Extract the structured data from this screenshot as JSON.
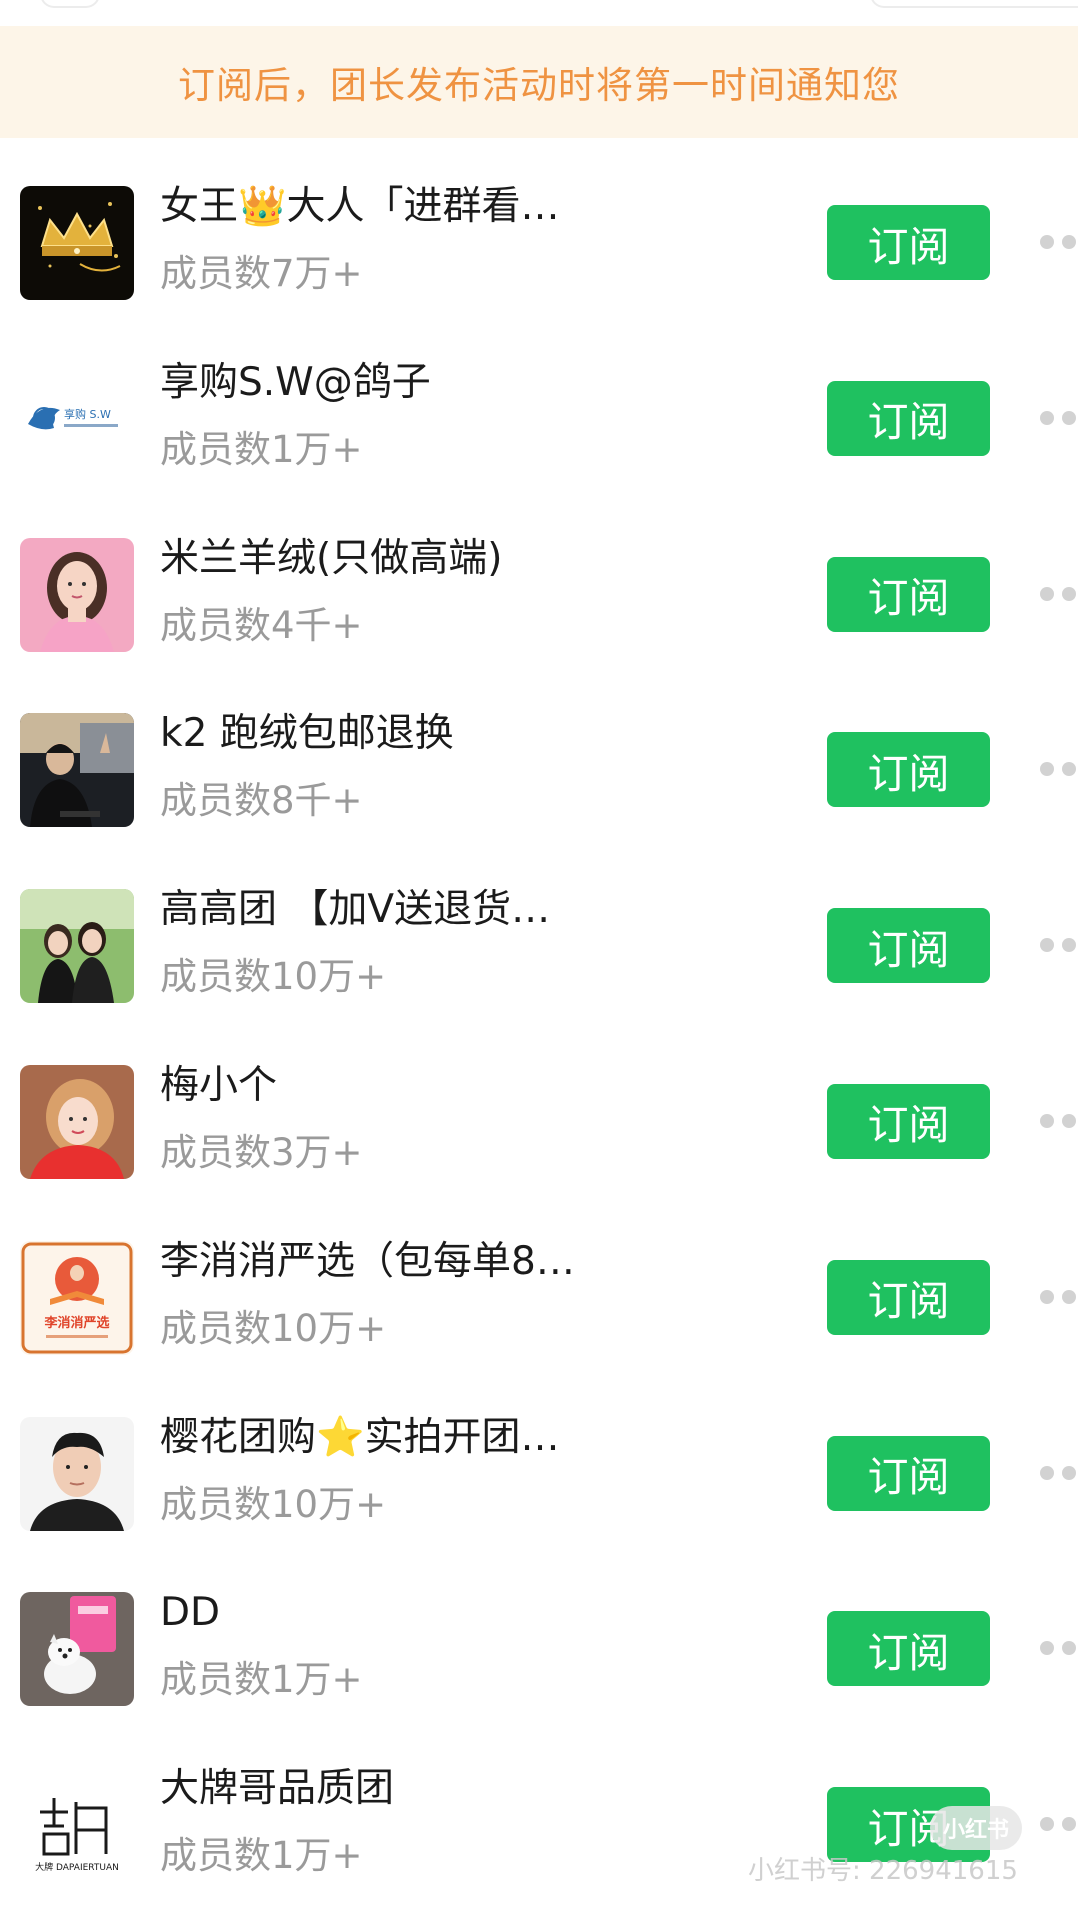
{
  "notice": "订阅后，团长发布活动时将第一时间通知您",
  "subscribe_label": "订阅",
  "accent_color": "#1fc160",
  "notice_color": "#ef9342",
  "items": [
    {
      "name": "女王👑大人「进群看…",
      "members": "成员数7万+",
      "avatar": "crown-avatar"
    },
    {
      "name": "享购S.W@鸽子",
      "members": "成员数1万+",
      "avatar": "dolphin-logo-avatar",
      "avatar_text": "享购 S.W"
    },
    {
      "name": "米兰羊绒(只做高端)",
      "members": "成员数4千+",
      "avatar": "woman-portrait-avatar"
    },
    {
      "name": "k2 跑绒包邮退换",
      "members": "成员数8千+",
      "avatar": "man-in-car-avatar"
    },
    {
      "name": "高高团 【加V送退货…",
      "members": "成员数10万+",
      "avatar": "two-women-avatar"
    },
    {
      "name": "梅小个",
      "members": "成员数3万+",
      "avatar": "girl-portrait-avatar"
    },
    {
      "name": "李消消严选（包每单8…",
      "members": "成员数10万+",
      "avatar": "book-logo-avatar",
      "avatar_text": "李消消严选"
    },
    {
      "name": "樱花团购⭐实拍开团…",
      "members": "成员数10万+",
      "avatar": "man-portrait-avatar"
    },
    {
      "name": "DD",
      "members": "成员数1万+",
      "avatar": "dog-avatar"
    },
    {
      "name": "大牌哥品质团",
      "members": "成员数1万+",
      "avatar": "dapaier-logo-avatar",
      "avatar_text": "大牌 DAPAIERTUAN"
    }
  ],
  "watermark": {
    "logo": "小红书",
    "text": "小红书号: 226941615"
  }
}
